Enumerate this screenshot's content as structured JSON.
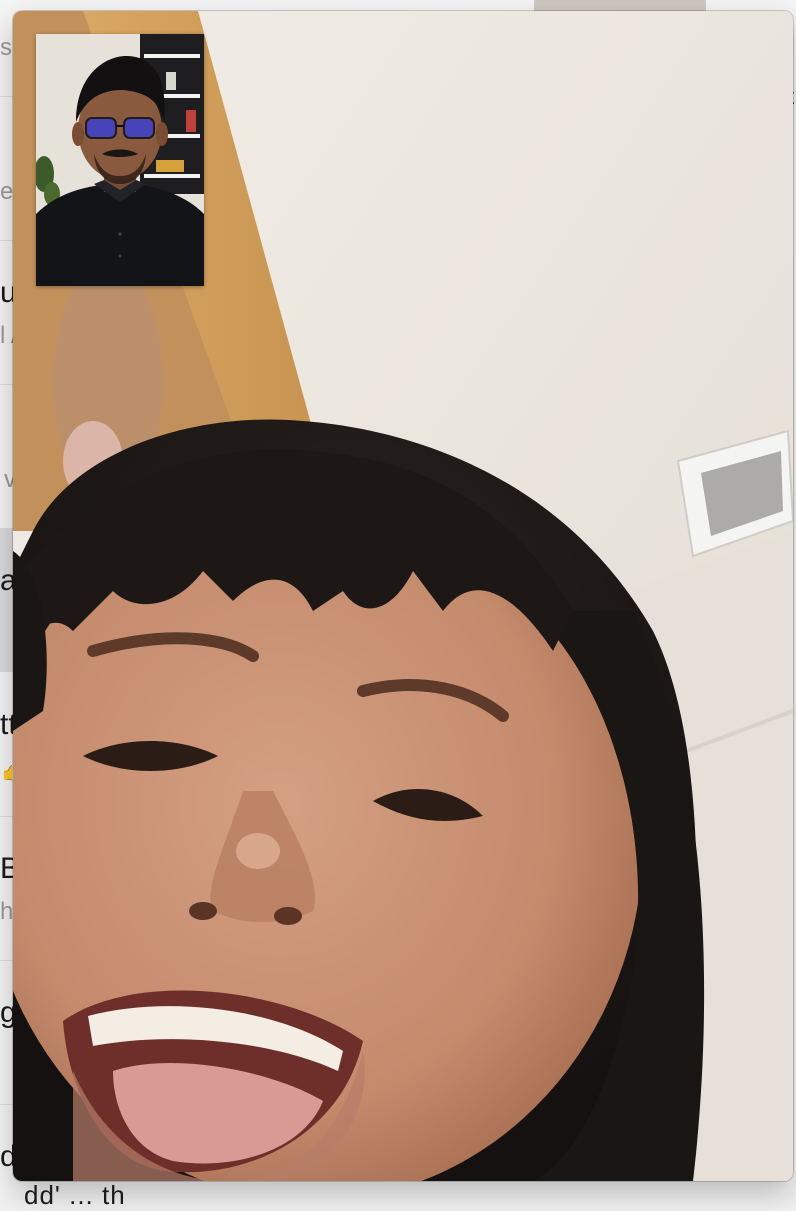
{
  "window": {
    "type": "video-call",
    "remote_participant_video": "remote-camera-feed",
    "self_view": "self-camera-preview"
  },
  "background_app": {
    "rows": [
      {
        "glyph": "s"
      },
      {
        "glyph": "e"
      },
      {
        "glyph": "ut"
      },
      {
        "glyph": "l A"
      },
      {
        "glyph": "v"
      },
      {
        "glyph": "a"
      },
      {
        "glyph": "tt"
      },
      {
        "glyph": "B"
      },
      {
        "glyph": "h"
      },
      {
        "glyph": "g"
      },
      {
        "glyph": "d"
      }
    ],
    "right_glyph": "t",
    "bottom_text": "dd' ... th",
    "thumb_icon": "thumbs-up-emoji"
  }
}
